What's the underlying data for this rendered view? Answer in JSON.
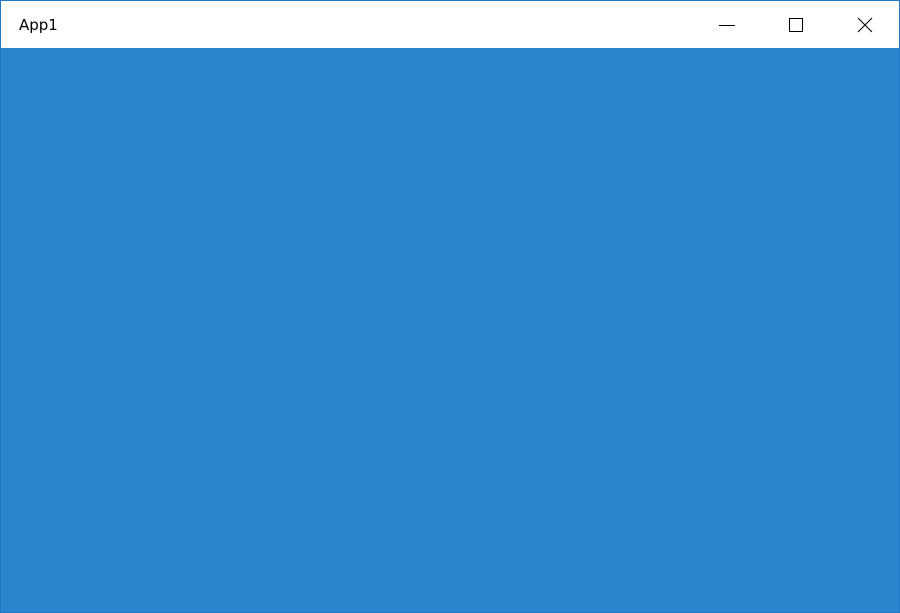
{
  "window": {
    "title": "App1",
    "content_color": "#2a86cd",
    "titlebar_color": "#ffffff"
  },
  "caption_buttons": {
    "minimize_icon": "minimize-icon",
    "maximize_icon": "maximize-icon",
    "close_icon": "close-icon"
  }
}
